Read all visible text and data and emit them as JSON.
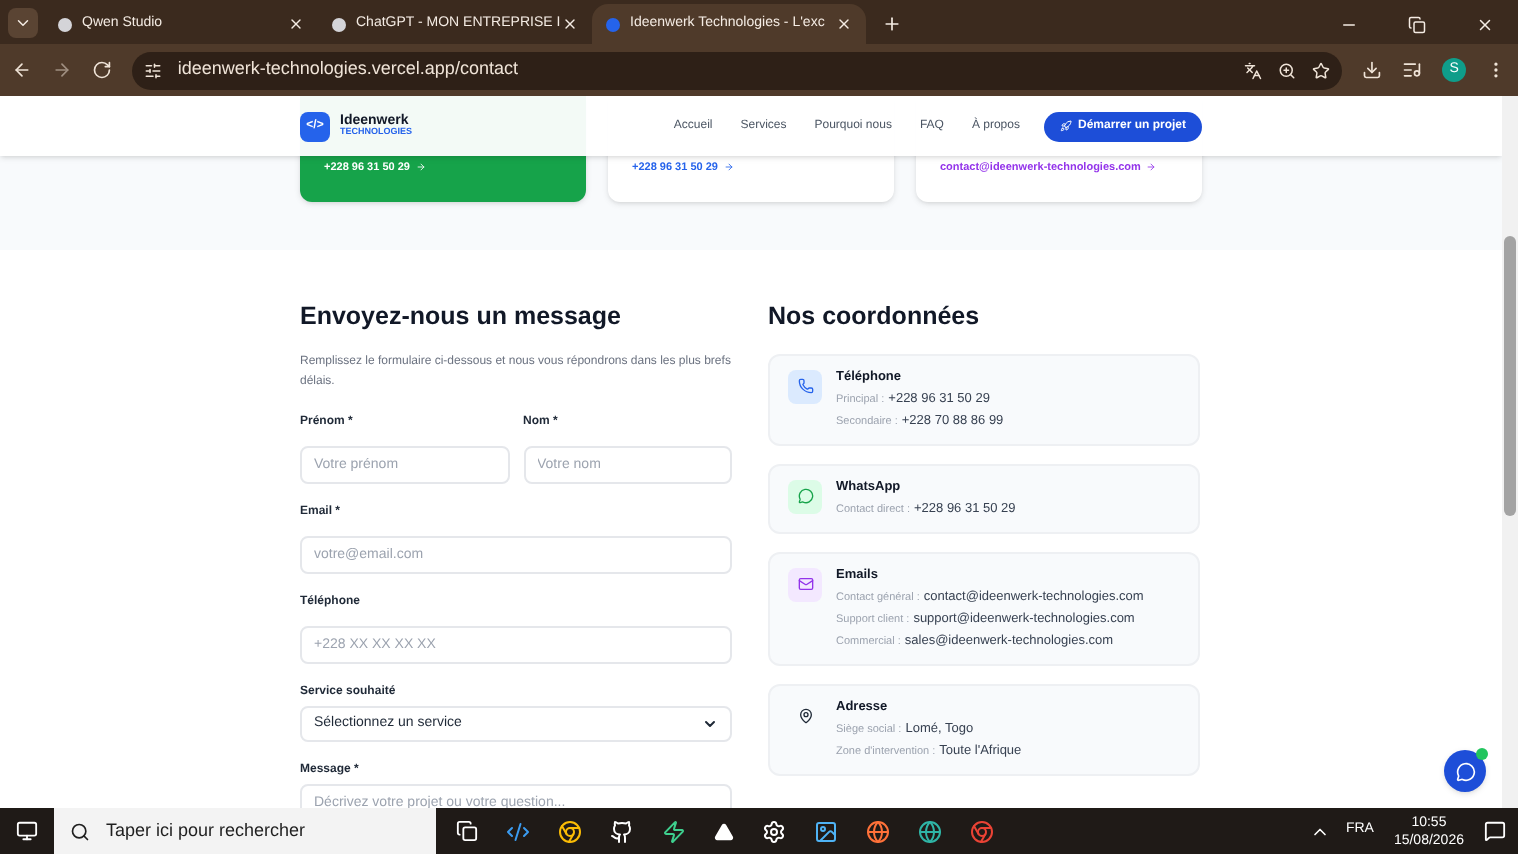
{
  "browser": {
    "tabs": [
      {
        "title": "Qwen Studio",
        "selected": false
      },
      {
        "title": "ChatGPT - MON ENTREPRISE I",
        "selected": false
      },
      {
        "title": "Ideenwerk Technologies - L'exc",
        "selected": true
      }
    ],
    "url": "ideenwerk-technologies.vercel.app/contact",
    "profile_initial": "S"
  },
  "site": {
    "logo_name": "Ideenwerk",
    "logo_sub": "TECHNOLOGIES",
    "logo_glyph": "</>",
    "nav": [
      "Accueil",
      "Services",
      "Pourquoi nous",
      "FAQ",
      "À propos"
    ],
    "cta": "Démarrer un projet"
  },
  "top_cards": [
    {
      "kind": "green",
      "link": "+228 96 31 50 29"
    },
    {
      "kind": "blue",
      "link": "+228 96 31 50 29"
    },
    {
      "kind": "purple",
      "link": "contact@ideenwerk-technologies.com"
    }
  ],
  "form": {
    "title": "Envoyez-nous un message",
    "intro": "Remplissez le formulaire ci-dessous et nous vous répondrons dans les plus brefs délais.",
    "rows": [
      [
        {
          "kind": "input",
          "label": "Prénom *",
          "placeholder": "Votre prénom"
        },
        {
          "kind": "input",
          "label": "Nom *",
          "placeholder": "Votre nom"
        }
      ],
      [
        {
          "kind": "input",
          "label": "Email *",
          "placeholder": "votre@email.com"
        }
      ],
      [
        {
          "kind": "input",
          "label": "Téléphone",
          "placeholder": "+228 XX XX XX XX"
        }
      ],
      [
        {
          "kind": "select",
          "label": "Service souhaité",
          "value": "Sélectionnez un service"
        }
      ],
      [
        {
          "kind": "textarea",
          "label": "Message *",
          "placeholder": "Décrivez votre projet ou votre question..."
        }
      ]
    ]
  },
  "contact": {
    "title": "Nos coordonnées",
    "cards": [
      {
        "kind": "phone",
        "title": "Téléphone",
        "lines": [
          {
            "label": "Principal :",
            "value": "+228 96 31 50 29"
          },
          {
            "label": "Secondaire :",
            "value": "+228 70 88 86 99"
          }
        ]
      },
      {
        "kind": "whatsapp",
        "title": "WhatsApp",
        "lines": [
          {
            "label": "Contact direct :",
            "value": "+228 96 31 50 29"
          }
        ]
      },
      {
        "kind": "email",
        "title": "Emails",
        "lines": [
          {
            "label": "Contact général :",
            "value": "contact@ideenwerk-technologies.com"
          },
          {
            "label": "Support client :",
            "value": "support@ideenwerk-technologies.com"
          },
          {
            "label": "Commercial :",
            "value": "sales@ideenwerk-technologies.com"
          }
        ]
      },
      {
        "kind": "location",
        "title": "Adresse",
        "lines": [
          {
            "label": "Siège social :",
            "value": "Lomé, Togo"
          },
          {
            "label": "Zone d'intervention :",
            "value": "Toute l'Afrique"
          }
        ]
      }
    ]
  },
  "taskbar": {
    "search_placeholder": "Taper ici pour rechercher",
    "language": "FRA",
    "time": "10:55",
    "date": "15/08/2026"
  }
}
